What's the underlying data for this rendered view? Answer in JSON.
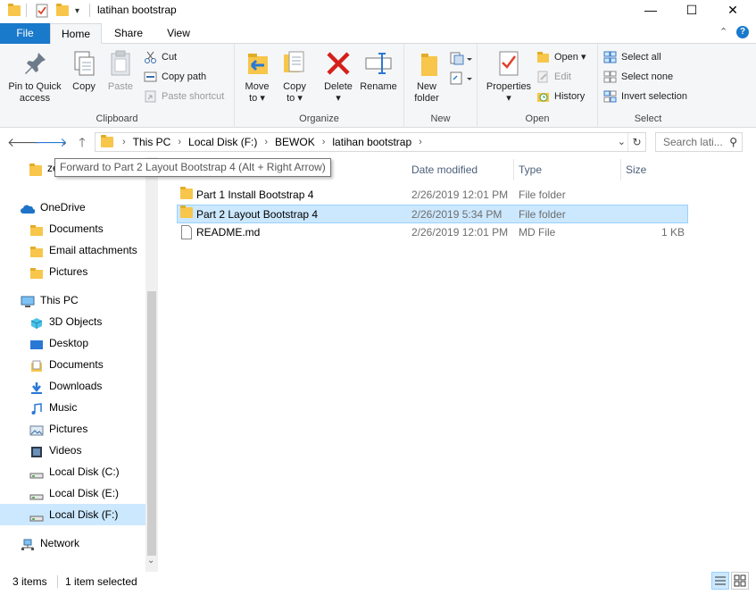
{
  "window": {
    "title": "latihan bootstrap",
    "minimize": "—",
    "maximize": "☐",
    "close": "✕"
  },
  "tabs": {
    "file": "File",
    "home": "Home",
    "share": "Share",
    "view": "View"
  },
  "ribbon": {
    "clipboard": {
      "label": "Clipboard",
      "pin": "Pin to Quick\naccess",
      "copy": "Copy",
      "paste": "Paste",
      "cut": "Cut",
      "copy_path": "Copy path",
      "paste_shortcut": "Paste shortcut"
    },
    "organize": {
      "label": "Organize",
      "move_to": "Move\nto ▾",
      "copy_to": "Copy\nto ▾",
      "delete": "Delete\n▾",
      "rename": "Rename"
    },
    "new": {
      "label": "New",
      "new_folder": "New\nfolder"
    },
    "open": {
      "label": "Open",
      "properties": "Properties\n▾",
      "open": "Open ▾",
      "edit": "Edit",
      "history": "History"
    },
    "select": {
      "label": "Select",
      "select_all": "Select all",
      "select_none": "Select none",
      "invert": "Invert selection"
    }
  },
  "address": {
    "crumbs": [
      "This PC",
      "Local Disk (F:)",
      "BEWOK",
      "latihan bootstrap"
    ],
    "search_placeholder": "Search lati..."
  },
  "tooltip": "Forward to Part 2 Layout Bootstrap 4 (Alt + Right Arrow)",
  "nav": {
    "partial_item": "ze",
    "items": [
      {
        "label": "OneDrive",
        "icon": "cloud-icon"
      },
      {
        "label": "Documents",
        "icon": "folder-icon"
      },
      {
        "label": "Email attachments",
        "icon": "folder-icon"
      },
      {
        "label": "Pictures",
        "icon": "folder-icon"
      },
      {
        "label": "This PC",
        "icon": "computer-icon"
      },
      {
        "label": "3D Objects",
        "icon": "cube-icon"
      },
      {
        "label": "Desktop",
        "icon": "desktop-icon"
      },
      {
        "label": "Documents",
        "icon": "documents-icon"
      },
      {
        "label": "Downloads",
        "icon": "download-icon"
      },
      {
        "label": "Music",
        "icon": "music-icon"
      },
      {
        "label": "Pictures",
        "icon": "pictures-icon"
      },
      {
        "label": "Videos",
        "icon": "video-icon"
      },
      {
        "label": "Local Disk (C:)",
        "icon": "drive-icon"
      },
      {
        "label": "Local Disk (E:)",
        "icon": "drive-icon"
      },
      {
        "label": "Local Disk (F:)",
        "icon": "drive-icon"
      },
      {
        "label": "Network",
        "icon": "network-icon"
      }
    ]
  },
  "columns": {
    "date": "Date modified",
    "type": "Type",
    "size": "Size"
  },
  "files": [
    {
      "name": "Part 1 Install Bootstrap 4",
      "date": "2/26/2019 12:01 PM",
      "type": "File folder",
      "size": ""
    },
    {
      "name": "Part 2 Layout Bootstrap 4",
      "date": "2/26/2019 5:34 PM",
      "type": "File folder",
      "size": ""
    },
    {
      "name": "README.md",
      "date": "2/26/2019 12:01 PM",
      "type": "MD File",
      "size": "1 KB"
    }
  ],
  "status": {
    "items": "3 items",
    "selected": "1 item selected"
  }
}
